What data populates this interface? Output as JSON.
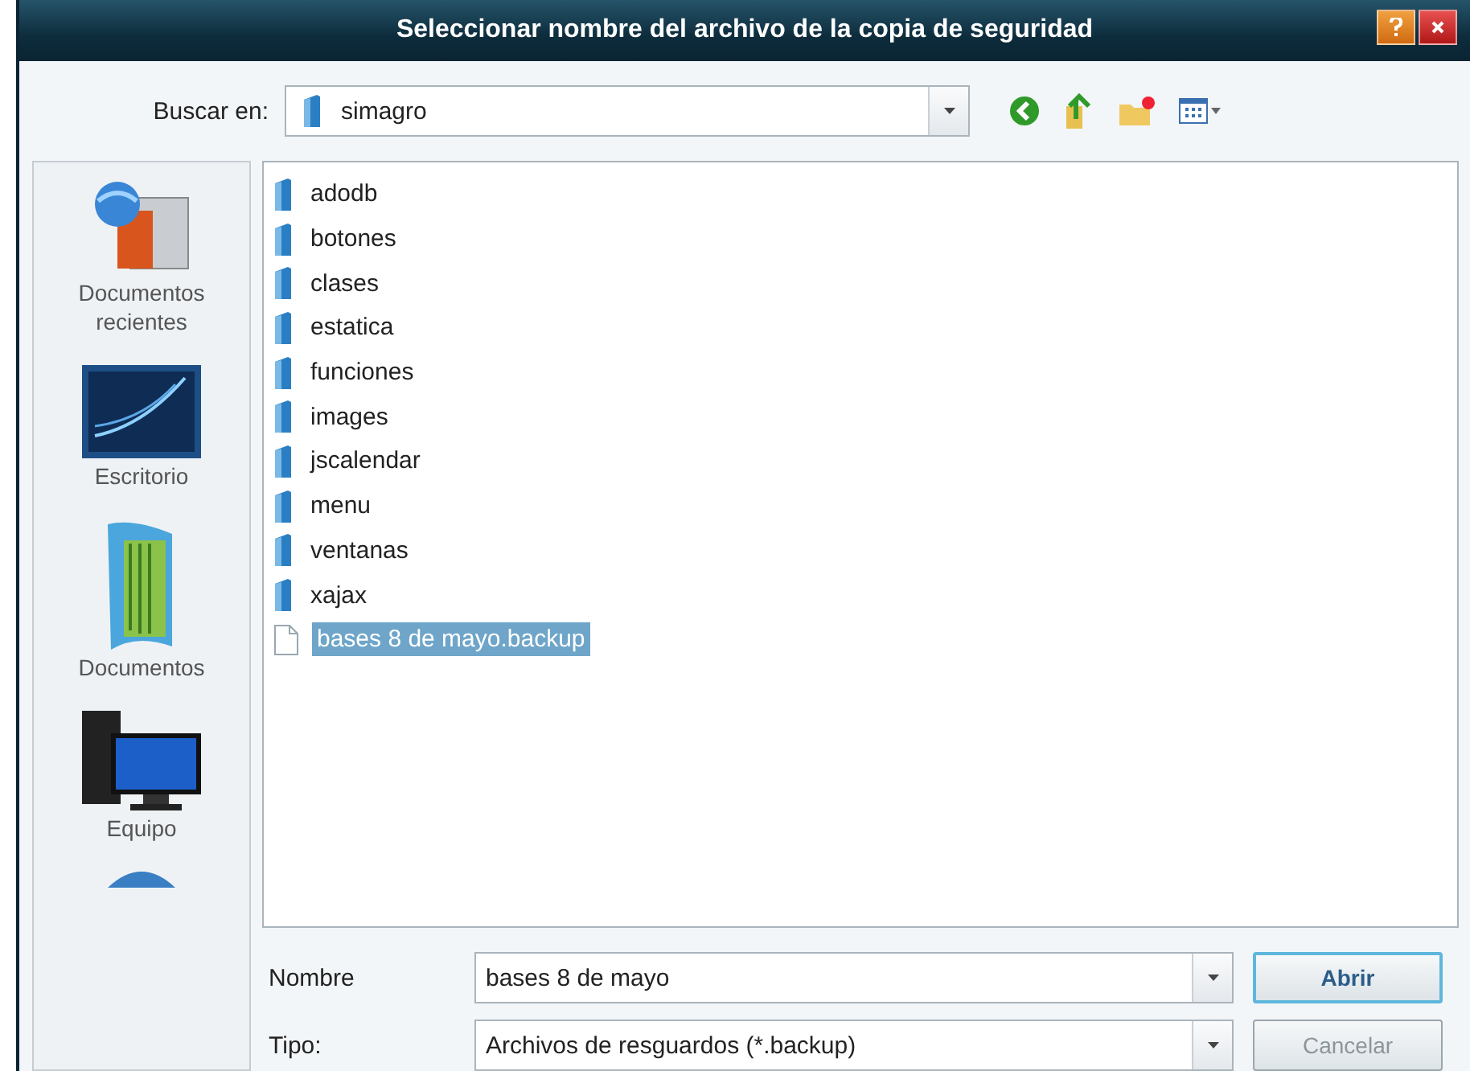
{
  "window": {
    "title": "Seleccionar nombre del archivo de la copia de seguridad"
  },
  "toolbar": {
    "label": "Buscar en:",
    "location": "simagro"
  },
  "sidebar": {
    "items": [
      {
        "label": "Documentos recientes",
        "kind": "recent"
      },
      {
        "label": "Escritorio",
        "kind": "desktop"
      },
      {
        "label": "Documentos",
        "kind": "documents"
      },
      {
        "label": "Equipo",
        "kind": "computer"
      },
      {
        "kind": "network"
      }
    ]
  },
  "files": [
    {
      "name": "adodb",
      "kind": "folder",
      "selected": false
    },
    {
      "name": "botones",
      "kind": "folder",
      "selected": false
    },
    {
      "name": "clases",
      "kind": "folder",
      "selected": false
    },
    {
      "name": "estatica",
      "kind": "folder",
      "selected": false
    },
    {
      "name": "funciones",
      "kind": "folder",
      "selected": false
    },
    {
      "name": "images",
      "kind": "folder",
      "selected": false
    },
    {
      "name": "jscalendar",
      "kind": "folder",
      "selected": false
    },
    {
      "name": "menu",
      "kind": "folder",
      "selected": false
    },
    {
      "name": "ventanas",
      "kind": "folder",
      "selected": false
    },
    {
      "name": "xajax",
      "kind": "folder",
      "selected": false
    },
    {
      "name": "bases 8 de mayo.backup",
      "kind": "file",
      "selected": true
    }
  ],
  "fields": [
    {
      "label": "Nombre",
      "value": "bases 8 de mayo"
    },
    {
      "label": "Tipo:",
      "value": "Archivos de resguardos (*.backup)"
    }
  ],
  "buttons": [
    {
      "label": "Abrir",
      "default": true,
      "disabled": false
    },
    {
      "label": "Cancelar",
      "default": false,
      "disabled": true
    }
  ]
}
